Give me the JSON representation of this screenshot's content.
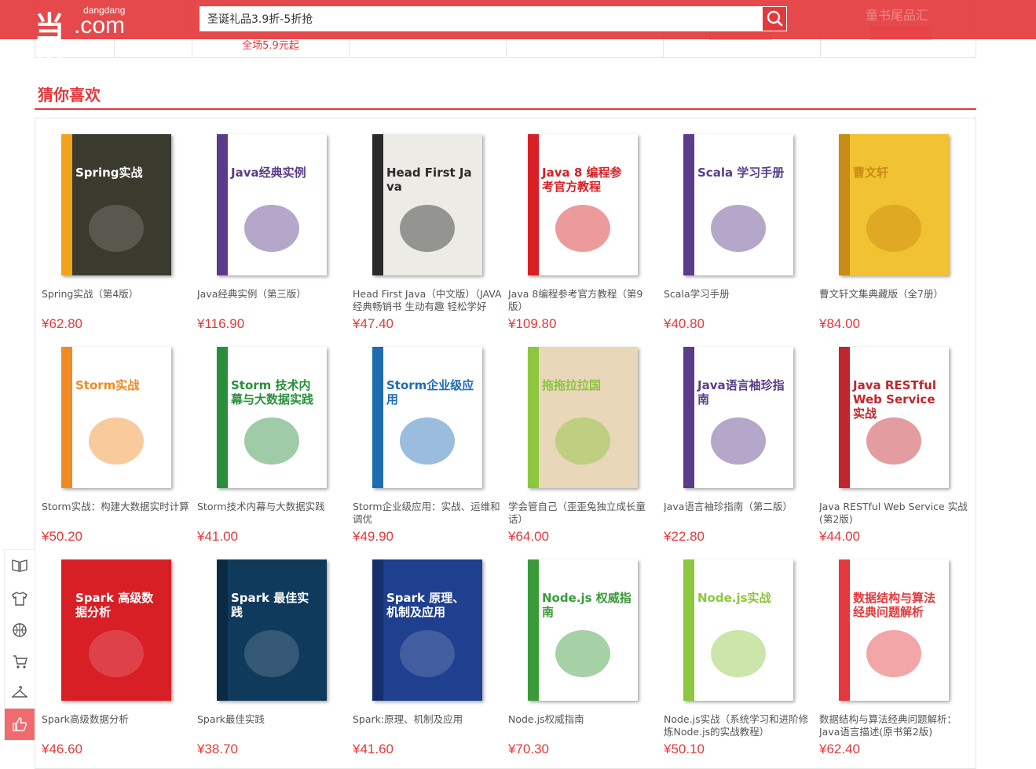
{
  "header": {
    "logo_mark": "当当",
    "logo_small": "dangdang",
    "logo_com": ".com",
    "search_value": "圣诞礼品3.9折-5折抢",
    "ghost_text": "童书尾品汇"
  },
  "promo": {
    "cell2_text": "全场5.9元起"
  },
  "section": {
    "title": "猜你喜欢"
  },
  "products": [
    {
      "name": "Spring实战（第4版）",
      "price": "¥62.80",
      "cover_title": "Spring实战",
      "cover_color": "#3a3a2e",
      "band": "#f2a31b"
    },
    {
      "name": "Java经典实例（第三版）",
      "price": "¥116.90",
      "cover_title": "Java经典实例",
      "cover_color": "#ffffff",
      "band": "#5a3c8a"
    },
    {
      "name": "Head First Java（中文版）（JAVA经典畅销书 生动有趣 轻松学好JAVA）",
      "price": "¥47.40",
      "cover_title": "Head First Java",
      "cover_color": "#ecebe6",
      "band": "#2b2b2b"
    },
    {
      "name": "Java 8编程参考官方教程（第9版）",
      "price": "¥109.80",
      "cover_title": "Java 8 编程参考官方教程",
      "cover_color": "#ffffff",
      "band": "#d81f26"
    },
    {
      "name": "Scala学习手册",
      "price": "¥40.80",
      "cover_title": "Scala 学习手册",
      "cover_color": "#ffffff",
      "band": "#5a3c8a"
    },
    {
      "name": "曹文轩文集典藏版（全7册）",
      "price": "¥84.00",
      "cover_title": "曹文轩",
      "cover_color": "#f1c232",
      "band": "#c98c12"
    },
    {
      "name": "Storm实战：构建大数据实时计算",
      "price": "¥50.20",
      "cover_title": "Storm实战",
      "cover_color": "#ffffff",
      "band": "#f08a24"
    },
    {
      "name": "Storm技术内幕与大数据实践",
      "price": "¥41.00",
      "cover_title": "Storm 技术内幕与大数据实践",
      "cover_color": "#ffffff",
      "band": "#2a8f3c"
    },
    {
      "name": "Storm企业级应用：实战、运维和调优",
      "price": "¥49.90",
      "cover_title": "Storm企业级应用",
      "cover_color": "#ffffff",
      "band": "#1e6db3"
    },
    {
      "name": "学会管自己（歪歪兔独立成长童话）",
      "price": "¥64.00",
      "cover_title": "拖拖拉拉国",
      "cover_color": "#e8d7b8",
      "band": "#8dc63f"
    },
    {
      "name": "Java语言袖珍指南（第二版）",
      "price": "¥22.80",
      "cover_title": "Java语言袖珍指南",
      "cover_color": "#ffffff",
      "band": "#5a3c8a"
    },
    {
      "name": "Java RESTful Web Service 实战(第2版)",
      "price": "¥44.00",
      "cover_title": "Java RESTful Web Service实战",
      "cover_color": "#ffffff",
      "band": "#c0262d"
    },
    {
      "name": "Spark高级数据分析",
      "price": "¥46.60",
      "cover_title": "Spark 高级数据分析",
      "cover_color": "#d81f26",
      "band": "#d81f26"
    },
    {
      "name": "Spark最佳实践",
      "price": "¥38.70",
      "cover_title": "Spark 最佳实践",
      "cover_color": "#0f3a5c",
      "band": "#0a2a44"
    },
    {
      "name": "Spark:原理、机制及应用",
      "price": "¥41.60",
      "cover_title": "Spark 原理、机制及应用",
      "cover_color": "#1f3f8f",
      "band": "#16306c"
    },
    {
      "name": "Node.js权威指南",
      "price": "¥70.30",
      "cover_title": "Node.js 权威指南",
      "cover_color": "#ffffff",
      "band": "#3a9a3a"
    },
    {
      "name": "Node.js实战（系统学习和进阶修炼Node.js的实战教程）",
      "price": "¥50.10",
      "cover_title": "Node.js实战",
      "cover_color": "#ffffff",
      "band": "#8dc63f"
    },
    {
      "name": "数据结构与算法经典问题解析：Java语言描述(原书第2版)",
      "price": "¥62.40",
      "cover_title": "数据结构与算法经典问题解析",
      "cover_color": "#ffffff",
      "band": "#e4393c"
    }
  ],
  "sidebar": [
    {
      "icon": "book-icon"
    },
    {
      "icon": "tshirt-icon"
    },
    {
      "icon": "ball-icon"
    },
    {
      "icon": "cart-icon"
    },
    {
      "icon": "hanger-icon"
    },
    {
      "icon": "thumbs-up-icon"
    }
  ],
  "colors": {
    "brand": "#e4393c"
  }
}
